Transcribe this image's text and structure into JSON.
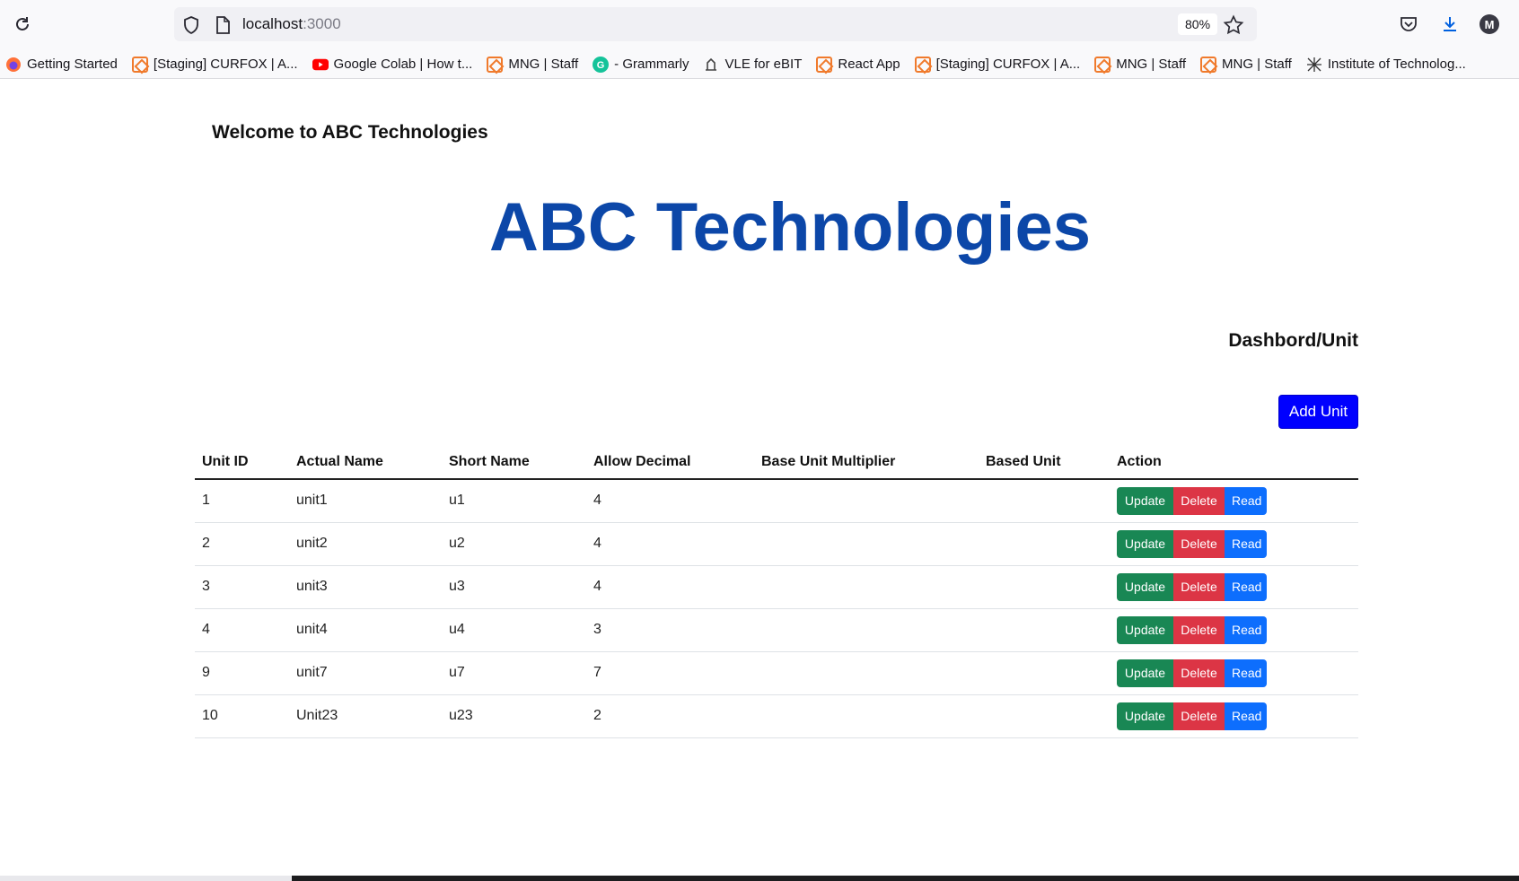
{
  "browser": {
    "url_host": "localhost",
    "url_port": ":3000",
    "zoom": "80%",
    "avatar_letter": "M",
    "bookmarks": [
      {
        "label": "Getting Started",
        "icon": "firefox-icon"
      },
      {
        "label": "[Staging] CURFOX | A...",
        "icon": "curfox-icon"
      },
      {
        "label": "Google Colab | How t...",
        "icon": "youtube-icon"
      },
      {
        "label": "MNG | Staff",
        "icon": "curfox-icon"
      },
      {
        "label": "- Grammarly",
        "icon": "grammarly-icon"
      },
      {
        "label": "VLE for eBIT",
        "icon": "vle-icon"
      },
      {
        "label": "React App",
        "icon": "curfox-icon"
      },
      {
        "label": "[Staging] CURFOX | A...",
        "icon": "curfox-icon"
      },
      {
        "label": "MNG | Staff",
        "icon": "curfox-icon"
      },
      {
        "label": "MNG | Staff",
        "icon": "curfox-icon"
      },
      {
        "label": "Institute of Technolog...",
        "icon": "institute-icon"
      }
    ]
  },
  "page": {
    "welcome": "Welcome to ABC Technologies",
    "hero_title": "ABC Technologies",
    "breadcrumb": "Dashbord/Unit",
    "add_button": "Add Unit"
  },
  "table": {
    "headers": [
      "Unit ID",
      "Actual Name",
      "Short Name",
      "Allow Decimal",
      "Base Unit Multiplier",
      "Based Unit",
      "Action"
    ],
    "rows": [
      {
        "id": "1",
        "actual": "unit1",
        "short": "u1",
        "decimal": "4",
        "multiplier": "",
        "based": ""
      },
      {
        "id": "2",
        "actual": "unit2",
        "short": "u2",
        "decimal": "4",
        "multiplier": "",
        "based": ""
      },
      {
        "id": "3",
        "actual": "unit3",
        "short": "u3",
        "decimal": "4",
        "multiplier": "",
        "based": ""
      },
      {
        "id": "4",
        "actual": "unit4",
        "short": "u4",
        "decimal": "3",
        "multiplier": "",
        "based": ""
      },
      {
        "id": "9",
        "actual": "unit7",
        "short": "u7",
        "decimal": "7",
        "multiplier": "",
        "based": ""
      },
      {
        "id": "10",
        "actual": "Unit23",
        "short": "u23",
        "decimal": "2",
        "multiplier": "",
        "based": ""
      }
    ],
    "actions": {
      "update": "Update",
      "delete": "Delete",
      "read": "Read"
    }
  },
  "colors": {
    "hero": "#0c47a8",
    "add_button": "#0000ff",
    "update": "#198754",
    "delete": "#dc3545",
    "read": "#0d6efd"
  }
}
